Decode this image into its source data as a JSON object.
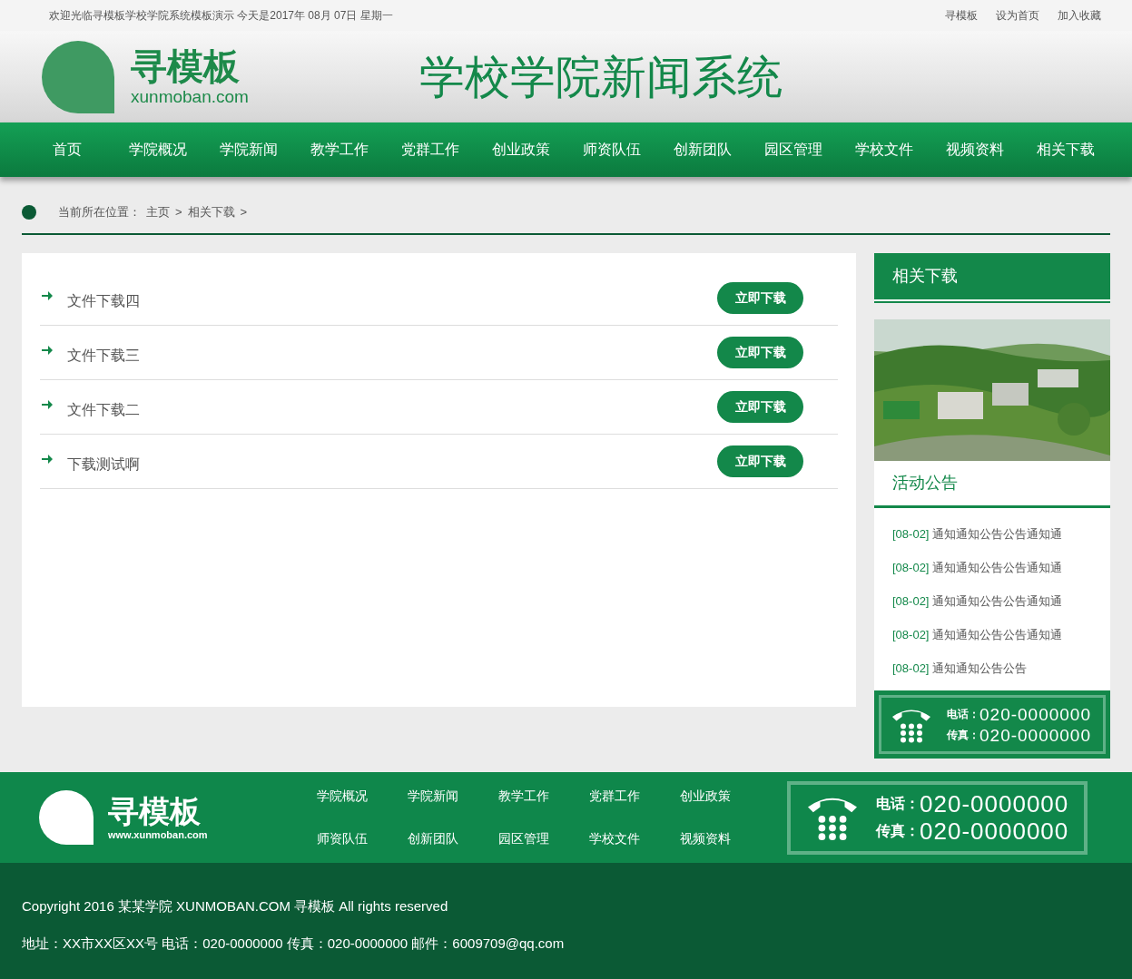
{
  "top_bar": {
    "welcome": "欢迎光临寻模板学校学院系统模板演示 今天是2017年 08月 07日 星期一",
    "links": [
      "寻模板",
      "设为首页",
      "加入收藏"
    ]
  },
  "header": {
    "logo_name": "寻模板",
    "logo_domain": "xunmoban.com",
    "site_title": "学校学院新闻系统"
  },
  "nav": [
    {
      "label": "首页"
    },
    {
      "label": "学院概况"
    },
    {
      "label": "学院新闻"
    },
    {
      "label": "教学工作"
    },
    {
      "label": "党群工作"
    },
    {
      "label": "创业政策"
    },
    {
      "label": "师资队伍"
    },
    {
      "label": "创新团队"
    },
    {
      "label": "园区管理"
    },
    {
      "label": "学校文件"
    },
    {
      "label": "视频资料"
    },
    {
      "label": "相关下载"
    }
  ],
  "breadcrumb": {
    "label": "当前所在位置：",
    "items": [
      "主页",
      ">",
      "相关下载",
      ">"
    ]
  },
  "downloads": [
    {
      "title": "文件下载四",
      "button": "立即下载"
    },
    {
      "title": "文件下载三",
      "button": "立即下载"
    },
    {
      "title": "文件下载二",
      "button": "立即下载"
    },
    {
      "title": "下载测试啊",
      "button": "立即下载"
    }
  ],
  "sidebar": {
    "title": "相关下载",
    "notice_title": "活动公告",
    "notices": [
      {
        "date": "[08-02]",
        "text": "通知通知公告公告通知通"
      },
      {
        "date": "[08-02]",
        "text": "通知通知公告公告通知通"
      },
      {
        "date": "[08-02]",
        "text": "通知通知公告公告通知通"
      },
      {
        "date": "[08-02]",
        "text": "通知通知公告公告通知通"
      },
      {
        "date": "[08-02]",
        "text": "通知通知公告公告"
      }
    ],
    "contact": {
      "phone_label": "电话：",
      "phone": "020-0000000",
      "fax_label": "传真：",
      "fax": "020-0000000"
    }
  },
  "footer": {
    "logo_name": "寻模板",
    "logo_domain": "www.xunmoban.com",
    "links": [
      "学院概况",
      "学院新闻",
      "教学工作",
      "党群工作",
      "创业政策",
      "师资队伍",
      "创新团队",
      "园区管理",
      "学校文件",
      "视频资料"
    ],
    "contact": {
      "phone_label": "电话：",
      "phone": "020-0000000",
      "fax_label": "传真：",
      "fax": "020-0000000"
    },
    "copyright": "Copyright 2016 某某学院 XUNMOBAN.COM 寻模板 All rights reserved",
    "address": "地址：XX市XX区XX号 电话：020-0000000 传真：020-0000000 邮件：6009709@qq.com"
  }
}
